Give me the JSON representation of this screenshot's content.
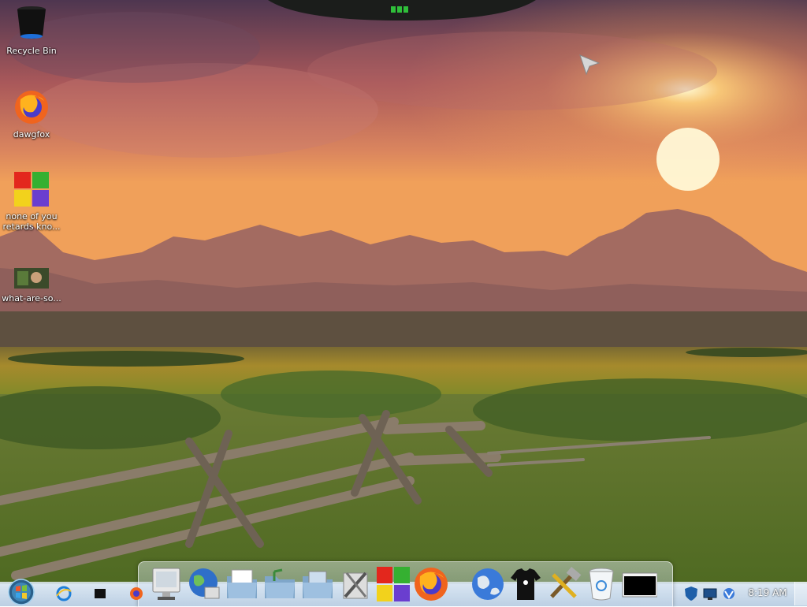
{
  "desktop": {
    "icons": [
      {
        "label": "Recycle Bin",
        "icon": "recycle-bin-icon"
      },
      {
        "label": "dawgfox",
        "icon": "firefox-icon"
      },
      {
        "label": "none of you retards kno...",
        "icon": "windows-logo-icon"
      },
      {
        "label": "what-are-so...",
        "icon": "image-thumbnail-icon"
      }
    ]
  },
  "dock": {
    "items": [
      {
        "icon": "system-monitor-icon"
      },
      {
        "icon": "network-globe-icon"
      },
      {
        "icon": "documents-folder-icon"
      },
      {
        "icon": "music-folder-icon"
      },
      {
        "icon": "pictures-folder-icon"
      },
      {
        "icon": "tools-icon"
      },
      {
        "icon": "windows-logo-icon"
      },
      {
        "icon": "firefox-icon"
      },
      {
        "icon": "internet-globe-icon"
      },
      {
        "icon": "tshirt-icon"
      },
      {
        "icon": "hammer-wrench-icon"
      },
      {
        "icon": "recycle-bin-icon"
      },
      {
        "icon": "desktop-screen-icon"
      }
    ]
  },
  "taskbar": {
    "start": {
      "icon": "windows-orb-icon"
    },
    "quick_launch": [
      {
        "icon": "internet-explorer-icon"
      },
      {
        "icon": "black-box-icon"
      },
      {
        "icon": "firefox-icon"
      }
    ],
    "tray": [
      {
        "icon": "security-shield-icon"
      },
      {
        "icon": "monitor-icon"
      },
      {
        "icon": "network-icon"
      }
    ],
    "clock": "8:19 AM"
  },
  "colors": {
    "sky_top": "#5a3d5c",
    "sky_glow": "#f5a65b",
    "sun": "#fff6c8",
    "mountains": "#8a5a5a",
    "field": "#a88a2a",
    "grass": "#5f7b2a"
  }
}
